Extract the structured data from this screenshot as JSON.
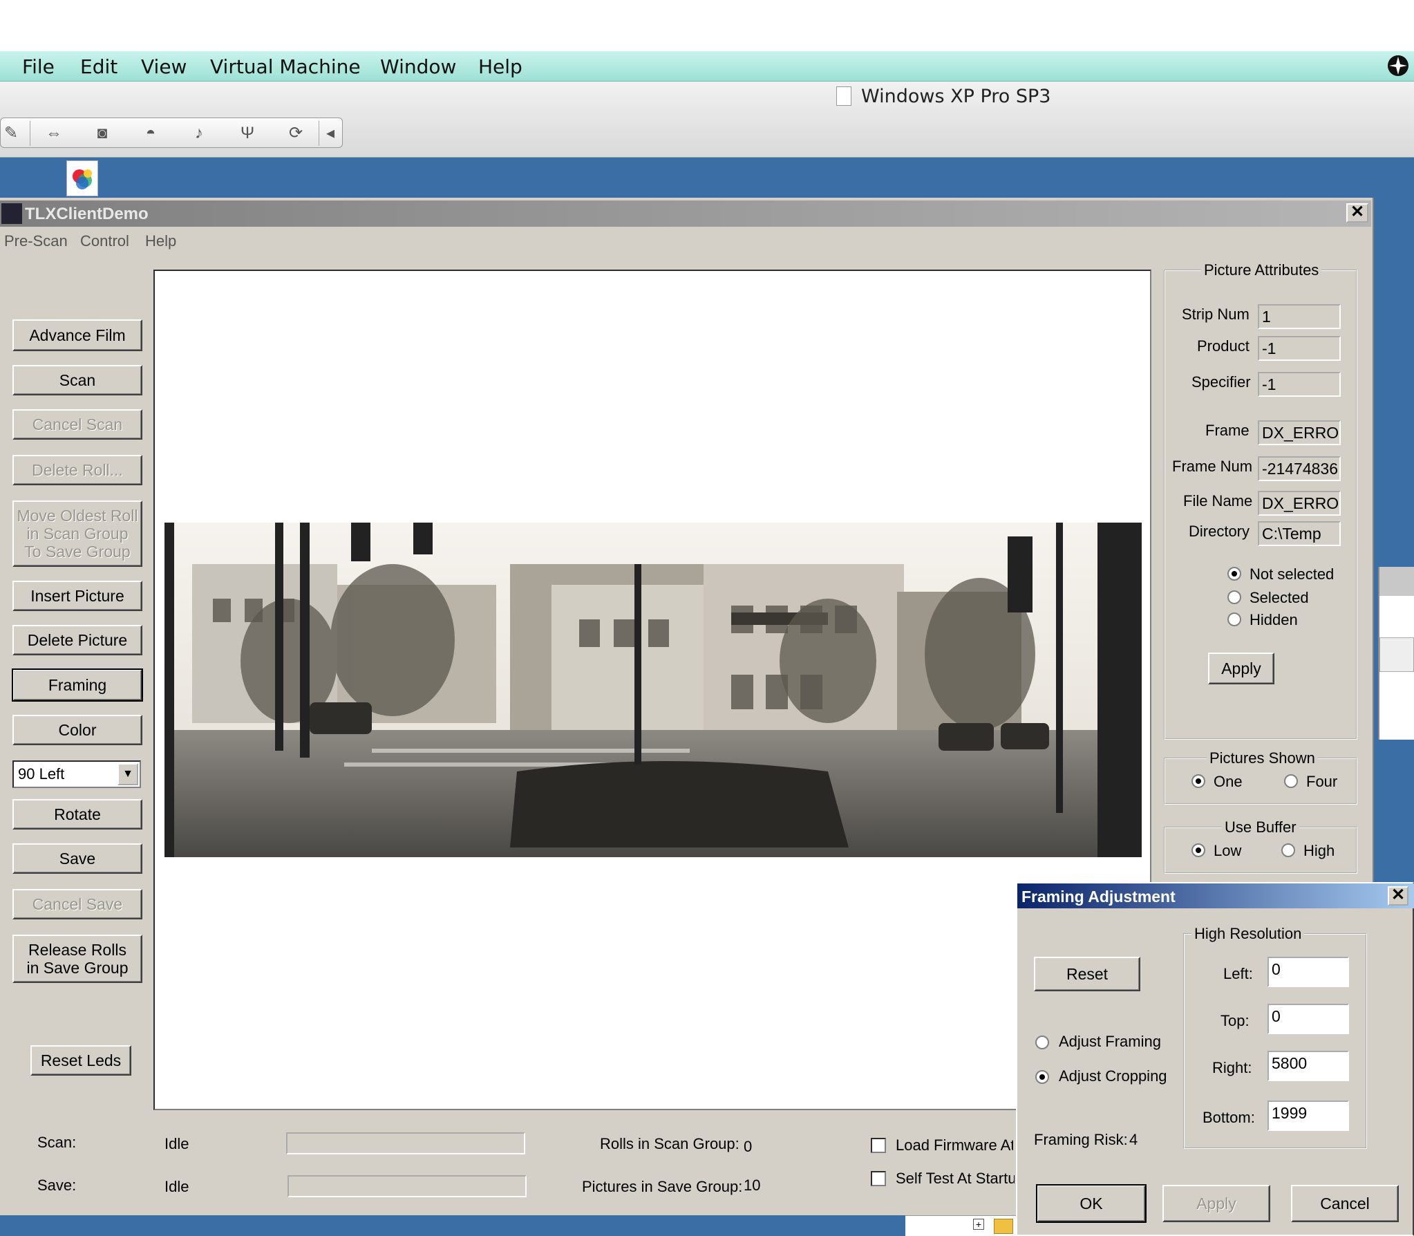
{
  "host": {
    "menu": [
      "File",
      "Edit",
      "View",
      "Virtual Machine",
      "Window",
      "Help"
    ],
    "vm_title": "Windows XP Pro SP3",
    "toolbar_icons": [
      "wrench-icon",
      "network-icon",
      "disk-icon",
      "cd-icon",
      "speaker-icon",
      "usb-icon",
      "sync-icon",
      "collapse-icon"
    ]
  },
  "app": {
    "title": "TLXClientDemo",
    "menu": [
      "Pre-Scan",
      "Control",
      "Help"
    ],
    "buttons": {
      "advance_film": "Advance Film",
      "scan": "Scan",
      "cancel_scan": "Cancel Scan",
      "delete_roll": "Delete Roll...",
      "move_oldest": "Move Oldest Roll in Scan Group To Save Group",
      "insert_picture": "Insert Picture",
      "delete_picture": "Delete Picture",
      "framing": "Framing",
      "color": "Color",
      "rotate": "Rotate",
      "save": "Save",
      "cancel_save": "Cancel Save",
      "release_rolls": "Release Rolls in Save Group",
      "reset_leds": "Reset Leds"
    },
    "rotation_select": "90 Left",
    "picture_attributes": {
      "title": "Picture Attributes",
      "strip_num_label": "Strip Num",
      "strip_num": "1",
      "product_label": "Product",
      "product": "-1",
      "specifier_label": "Specifier",
      "specifier": "-1",
      "frame_label": "Frame",
      "frame": "DX_ERRO",
      "frame_num_label": "Frame Num",
      "frame_num": "-21474836",
      "file_name_label": "File Name",
      "file_name": "DX_ERRO",
      "directory_label": "Directory",
      "directory": "C:\\Temp",
      "radio_not_selected": "Not selected",
      "radio_selected": "Selected",
      "radio_hidden": "Hidden",
      "apply": "Apply"
    },
    "pictures_shown": {
      "title": "Pictures Shown",
      "one": "One",
      "four": "Four"
    },
    "use_buffer": {
      "title": "Use Buffer",
      "low": "Low",
      "high": "High"
    },
    "status": {
      "scan_label": "Scan:",
      "scan_value": "Idle",
      "save_label": "Save:",
      "save_value": "Idle",
      "rolls_label": "Rolls in Scan Group:",
      "rolls_value": "0",
      "pictures_label": "Pictures in Save Group:",
      "pictures_value": "10",
      "load_firmware": "Load Firmware At",
      "self_test": "Self Test At Startu"
    }
  },
  "framing_dialog": {
    "title": "Framing Adjustment",
    "reset": "Reset",
    "adjust_framing": "Adjust Framing",
    "adjust_cropping": "Adjust Cropping",
    "framing_risk_label": "Framing Risk:",
    "framing_risk": "4",
    "group_title": "High Resolution",
    "left_label": "Left:",
    "left": "0",
    "top_label": "Top:",
    "top": "0",
    "right_label": "Right:",
    "right": "5800",
    "bottom_label": "Bottom:",
    "bottom": "1999",
    "ok": "OK",
    "apply": "Apply",
    "cancel": "Cancel"
  },
  "colors": {
    "desktop": "#3a6ea5",
    "dialog_face": "#d4d0c8",
    "host_menubar": "#b4ebe1",
    "dialog_title": "#0a246a"
  }
}
